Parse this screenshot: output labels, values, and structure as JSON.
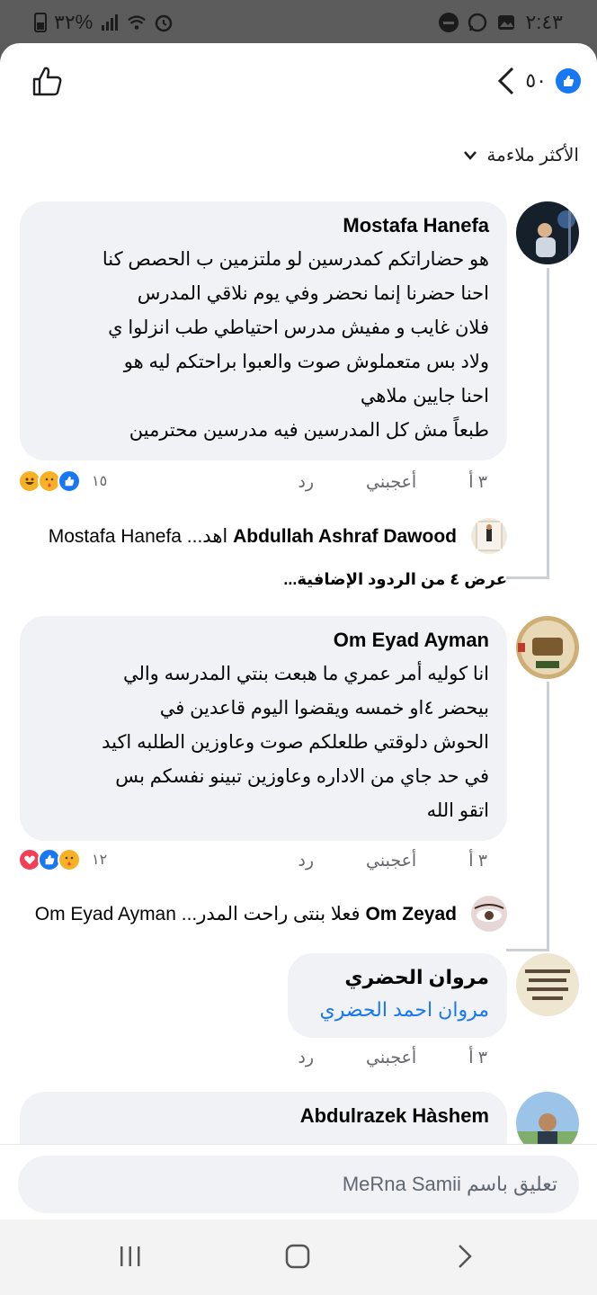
{
  "status_bar": {
    "time": "٢:٤٣",
    "battery": "٣٢%"
  },
  "header": {
    "reaction_count": "٥٠"
  },
  "sort": {
    "label": "الأكثر ملاءمة"
  },
  "comments": [
    {
      "name": "Mostafa Hanefa",
      "lines": [
        "هو حضاراتكم كمدرسين لو ملتزمين ب الحصص كنا",
        "احنا حضرنا إنما نحضر وفي  يوم نلاقي المدرس",
        "فلان غايب و مفيش مدرس احتياطي طب انزلوا ي",
        "ولاد بس متعملوش صوت والعبوا براحتكم ليه هو",
        "احنا جايين ملاهي",
        "طبعاً مش كل المدرسين فيه مدرسين محترمين"
      ],
      "time": "٣ أ",
      "like_label": "أعجبني",
      "reply_label": "رد",
      "reaction_count": "١٥",
      "reply_preview": {
        "name": "Abdullah Ashraf Dawood",
        "text": "اهد... Mostafa Hanefa"
      },
      "more_replies": "عرض ٤ من الردود الإضافية..."
    },
    {
      "name": "Om Eyad Ayman",
      "lines": [
        "انا كوليه أمر عمري ما هبعت بنتي المدرسه والي",
        "بيحضر ٤او خمسه ويقضوا اليوم قاعدين في",
        "الحوش دلوقتي طلعلكم  صوت وعاوزين الطلبه اكيد",
        "في حد جاي من الاداره وعاوزين تبينو نفسكم بس",
        "اتقو الله"
      ],
      "time": "٣ أ",
      "like_label": "أعجبني",
      "reply_label": "رد",
      "reaction_count": "١٢",
      "reply_preview": {
        "name": "Om Zeyad",
        "text": "فعلا بنتى راحت المدر... Om Eyad Ayman"
      }
    },
    {
      "name": "مروان الحضري",
      "link_text": "مروان احمد الحضري",
      "time": "٣ أ",
      "like_label": "أعجبني",
      "reply_label": "رد"
    },
    {
      "name": "Abdulrazek Hàshem"
    }
  ],
  "composer": {
    "placeholder": "تعليق باسم MeRna Samii"
  },
  "colors": {
    "accent": "#1877f2",
    "bubble": "#f0f2f5",
    "love": "#f33e58",
    "haha": "#f7b125"
  }
}
